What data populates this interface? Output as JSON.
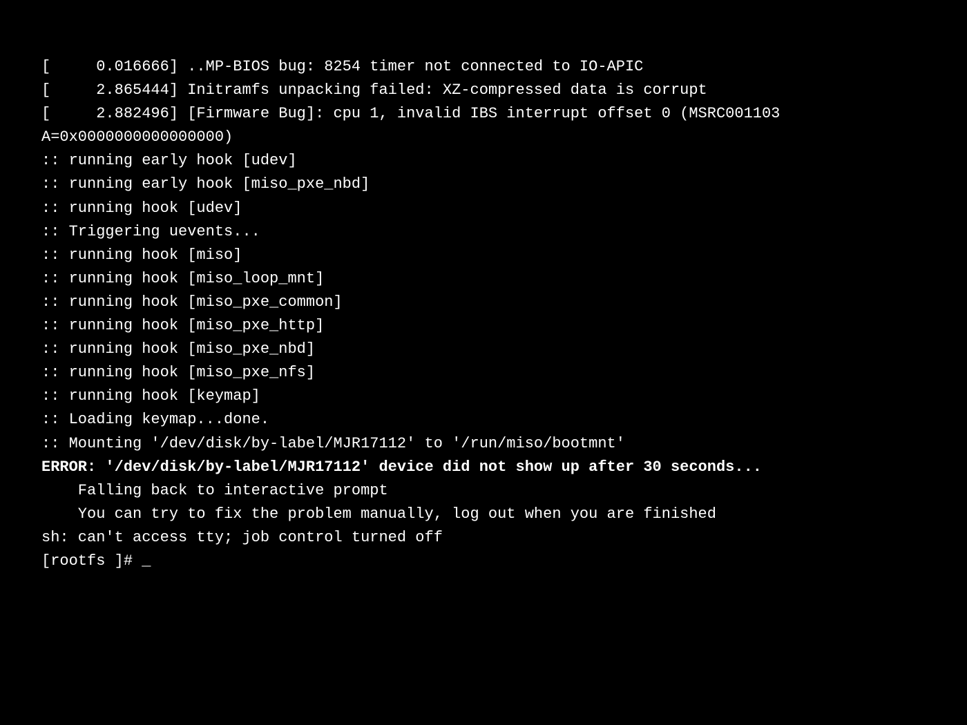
{
  "terminal": {
    "lines": [
      {
        "id": "line1",
        "text": "[     0.016666] ..MP-BIOS bug: 8254 timer not connected to IO-APIC",
        "type": "normal"
      },
      {
        "id": "line2",
        "text": "[     2.865444] Initramfs unpacking failed: XZ-compressed data is corrupt",
        "type": "normal"
      },
      {
        "id": "line3",
        "text": "[     2.882496] [Firmware Bug]: cpu 1, invalid IBS interrupt offset 0 (MSRC001103",
        "type": "normal"
      },
      {
        "id": "line4",
        "text": "A=0x0000000000000000)",
        "type": "normal"
      },
      {
        "id": "line5",
        "text": ":: running early hook [udev]",
        "type": "normal"
      },
      {
        "id": "line6",
        "text": ":: running early hook [miso_pxe_nbd]",
        "type": "normal"
      },
      {
        "id": "line7",
        "text": ":: running hook [udev]",
        "type": "normal"
      },
      {
        "id": "line8",
        "text": ":: Triggering uevents...",
        "type": "normal"
      },
      {
        "id": "line9",
        "text": ":: running hook [miso]",
        "type": "normal"
      },
      {
        "id": "line10",
        "text": ":: running hook [miso_loop_mnt]",
        "type": "normal"
      },
      {
        "id": "line11",
        "text": ":: running hook [miso_pxe_common]",
        "type": "normal"
      },
      {
        "id": "line12",
        "text": ":: running hook [miso_pxe_http]",
        "type": "normal"
      },
      {
        "id": "line13",
        "text": ":: running hook [miso_pxe_nbd]",
        "type": "normal"
      },
      {
        "id": "line14",
        "text": ":: running hook [miso_pxe_nfs]",
        "type": "normal"
      },
      {
        "id": "line15",
        "text": ":: running hook [keymap]",
        "type": "normal"
      },
      {
        "id": "line16",
        "text": ":: Loading keymap...done.",
        "type": "normal"
      },
      {
        "id": "line17",
        "text": ":: Mounting '/dev/disk/by-label/MJR17112' to '/run/miso/bootmnt'",
        "type": "normal"
      },
      {
        "id": "line18",
        "text": "ERROR: '/dev/disk/by-label/MJR17112' device did not show up after 30 seconds...",
        "type": "error"
      },
      {
        "id": "line19",
        "text": "    Falling back to interactive prompt",
        "type": "normal"
      },
      {
        "id": "line20",
        "text": "    You can try to fix the problem manually, log out when you are finished",
        "type": "normal"
      },
      {
        "id": "line21",
        "text": "sh: can't access tty; job control turned off",
        "type": "normal"
      },
      {
        "id": "line22",
        "text": "[rootfs ]# _",
        "type": "prompt"
      }
    ]
  }
}
